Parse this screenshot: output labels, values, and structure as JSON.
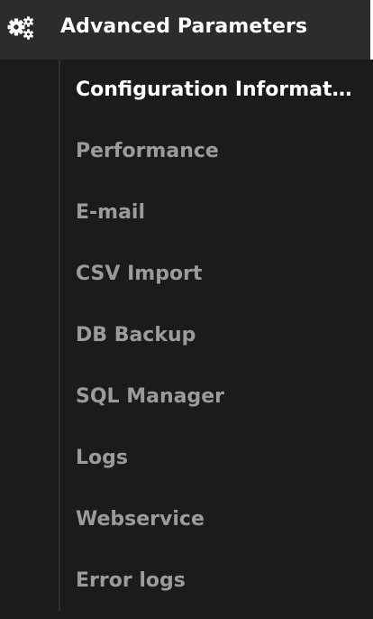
{
  "header": {
    "icon": "gears-icon",
    "title": "Advanced Parameters"
  },
  "submenu": {
    "items": [
      {
        "label": "Configuration Information",
        "active": true
      },
      {
        "label": "Performance",
        "active": false
      },
      {
        "label": "E-mail",
        "active": false
      },
      {
        "label": "CSV Import",
        "active": false
      },
      {
        "label": "DB Backup",
        "active": false
      },
      {
        "label": "SQL Manager",
        "active": false
      },
      {
        "label": "Logs",
        "active": false
      },
      {
        "label": "Webservice",
        "active": false
      },
      {
        "label": "Error logs",
        "active": false
      }
    ]
  },
  "colors": {
    "background": "#1b1b1c",
    "header_background": "#2b2c2e",
    "active_text": "#ffffff",
    "inactive_text": "#9b9b9b"
  }
}
